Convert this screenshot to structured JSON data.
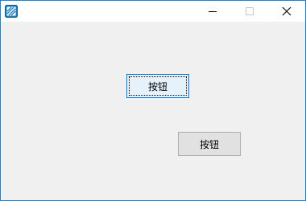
{
  "window": {
    "title": "",
    "caption_buttons": {
      "minimize_icon": "minimize-icon",
      "maximize_icon": "maximize-icon",
      "close_icon": "close-icon"
    },
    "accent_color": "#1883d7"
  },
  "content": {
    "button_1": {
      "label": "按钮",
      "state": "focused"
    },
    "button_2": {
      "label": "按钮",
      "state": "normal"
    }
  }
}
